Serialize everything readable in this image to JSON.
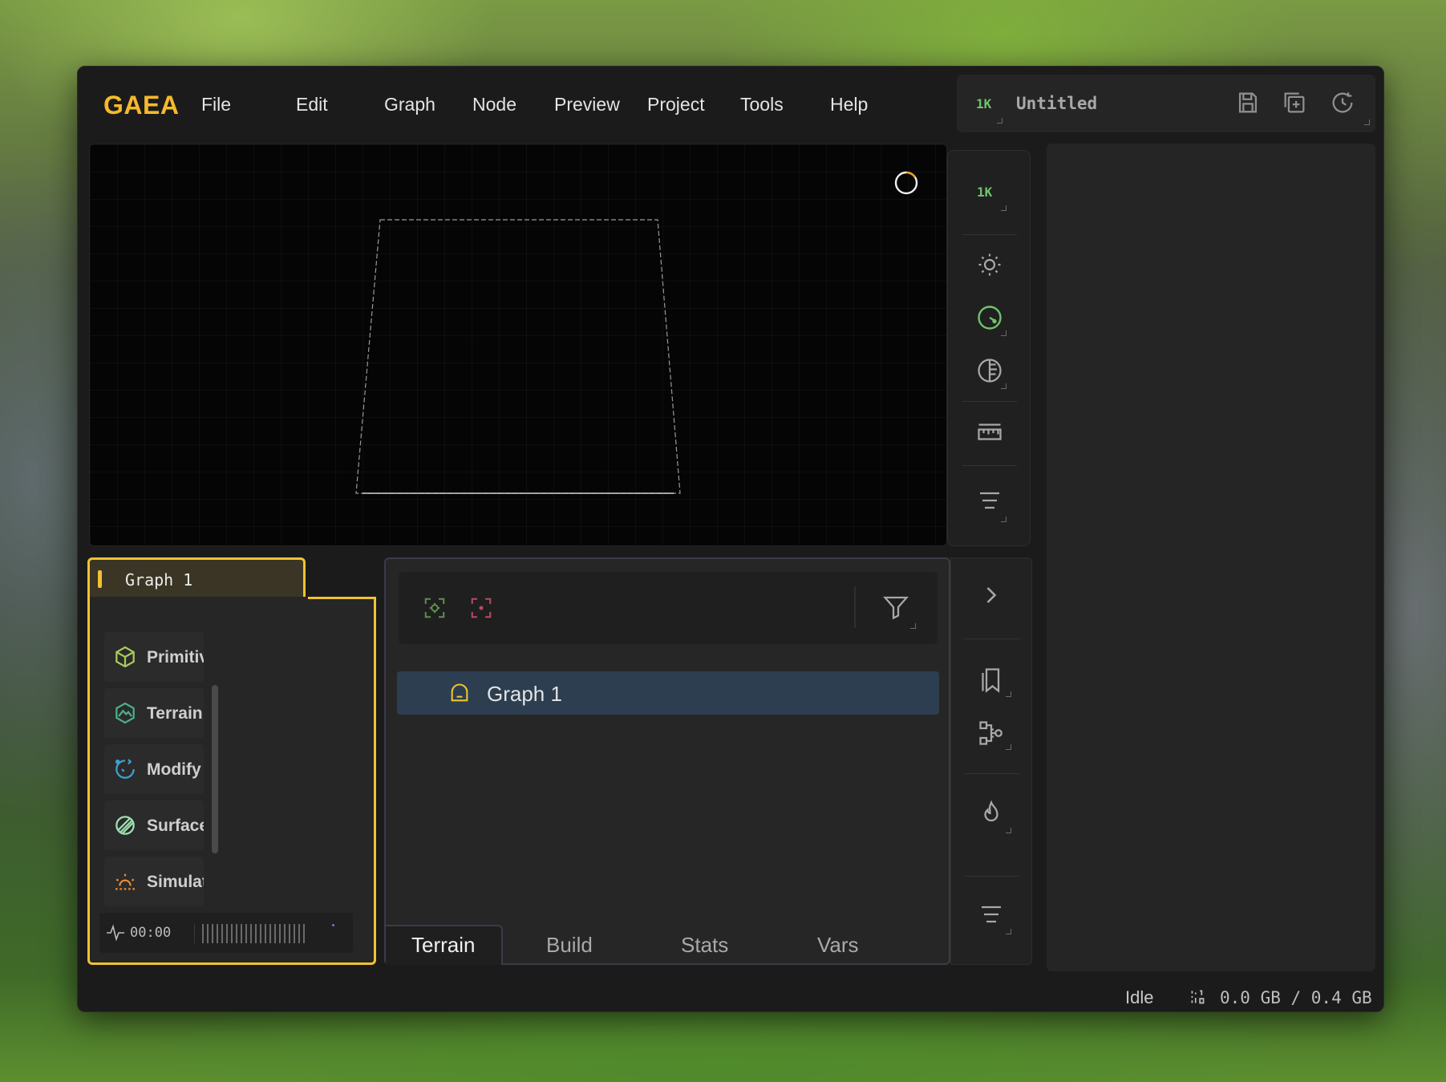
{
  "app": {
    "logo": "GAEA"
  },
  "menu": [
    "File",
    "Edit",
    "Graph",
    "Node",
    "Preview",
    "Project",
    "Tools",
    "Help"
  ],
  "project": {
    "resolution_badge": "1K",
    "title": "Untitled"
  },
  "viewport_toolbar": {
    "resolution_badge": "1K"
  },
  "graph_panel": {
    "tab_label": "Graph 1",
    "categories": [
      {
        "label": "Primitives",
        "icon": "cube-icon",
        "color": "#a9c95a"
      },
      {
        "label": "Terrain",
        "icon": "mountain-icon",
        "color": "#4caf8a"
      },
      {
        "label": "Modify",
        "icon": "modify-icon",
        "color": "#3fa0d0"
      },
      {
        "label": "Surface",
        "icon": "surface-icon",
        "color": "#9fe0b0"
      },
      {
        "label": "Simulate",
        "icon": "sun-icon",
        "color": "#e58a3c"
      }
    ],
    "timer": "00:00"
  },
  "explorer": {
    "tree_items": [
      {
        "label": "Graph 1",
        "icon": "graph-icon"
      }
    ],
    "tabs": [
      "Terrain",
      "Build",
      "Stats",
      "Vars"
    ],
    "active_tab": "Terrain"
  },
  "status": {
    "state": "Idle",
    "memory": "0.0 GB / 0.4 GB"
  },
  "colors": {
    "accent": "#f1c232",
    "brand": "#f5b92b",
    "selection": "#2c3e50",
    "badge_green": "#6fc46a"
  }
}
